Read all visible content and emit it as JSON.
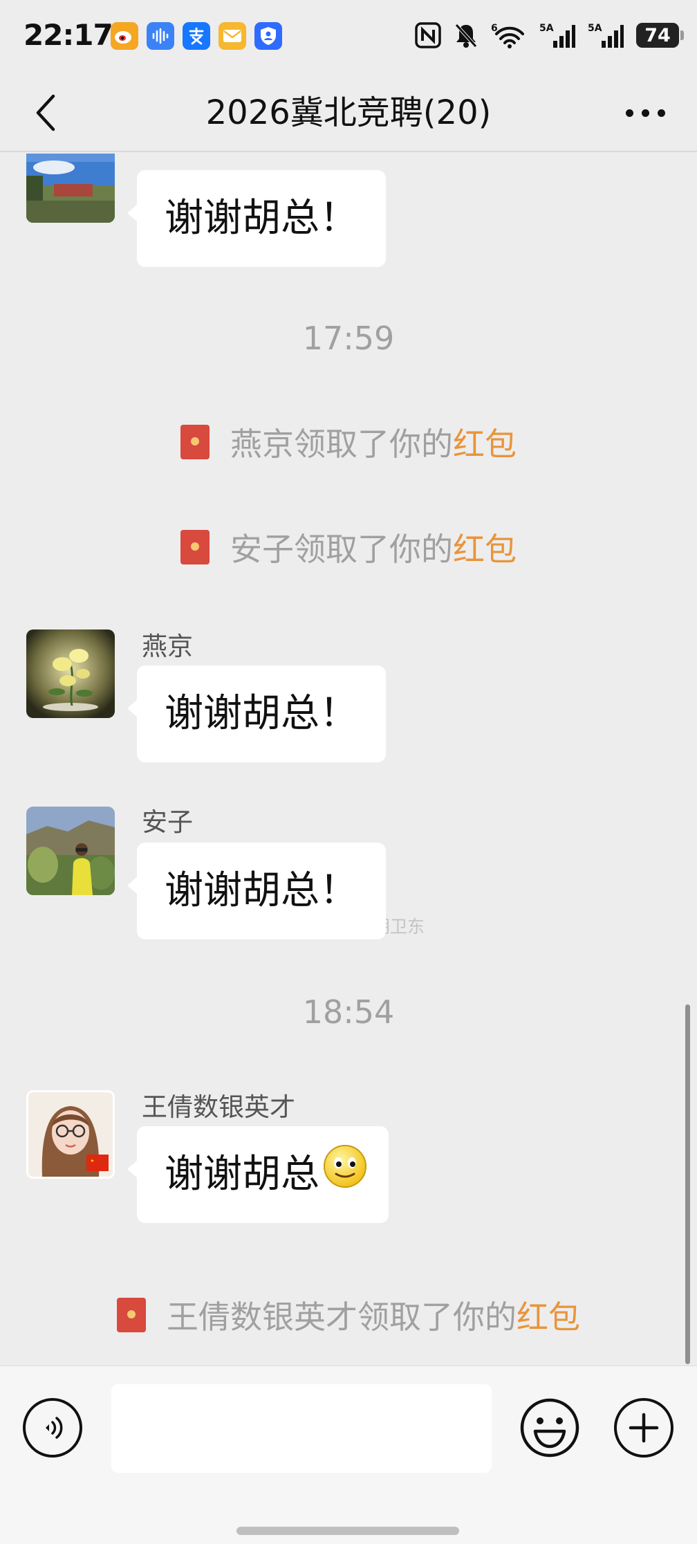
{
  "status_bar": {
    "time": "22:17",
    "notification_icons": [
      {
        "name": "weibo-icon",
        "color": "#f5a623",
        "glyph": "◉"
      },
      {
        "name": "voice-memo-icon",
        "color": "#3b82f6",
        "glyph": "⦀"
      },
      {
        "name": "alipay-icon",
        "color": "#1677ff",
        "glyph": "支"
      },
      {
        "name": "mail-icon",
        "color": "#f5b82e",
        "glyph": "✉"
      },
      {
        "name": "shield-icon",
        "color": "#2f6bff",
        "glyph": "⛨"
      }
    ],
    "nfc_label": "N",
    "wifi_label": "6",
    "signal_1_label": "5A",
    "signal_2_label": "5A",
    "battery_level": "74"
  },
  "header": {
    "title": "2026冀北竞聘(20)"
  },
  "chat": {
    "messages": [
      {
        "type": "text",
        "sender": "",
        "text": "谢谢胡总！"
      },
      {
        "type": "time",
        "text": "17:59"
      },
      {
        "type": "redpacket",
        "prefix": "燕京领取了你的",
        "link": "红包"
      },
      {
        "type": "redpacket",
        "prefix": "安子领取了你的",
        "link": "红包"
      },
      {
        "type": "text",
        "sender": "燕京",
        "text": "谢谢胡总！"
      },
      {
        "type": "text",
        "sender": "安子",
        "text": "谢谢胡总！"
      },
      {
        "type": "time",
        "text": "18:54"
      },
      {
        "type": "text",
        "sender": "王倩数银英才",
        "text": "谢谢胡总"
      },
      {
        "type": "redpacket",
        "prefix": "王倩数银英才领取了你的",
        "link": "红包"
      }
    ],
    "watermark": "@人力资源胡卫东"
  },
  "input_bar": {
    "placeholder": ""
  },
  "colors": {
    "background": "#ededed",
    "bubble": "#ffffff",
    "redpacket_link": "#e9943a",
    "redpacket_icon": "#d8493e"
  }
}
